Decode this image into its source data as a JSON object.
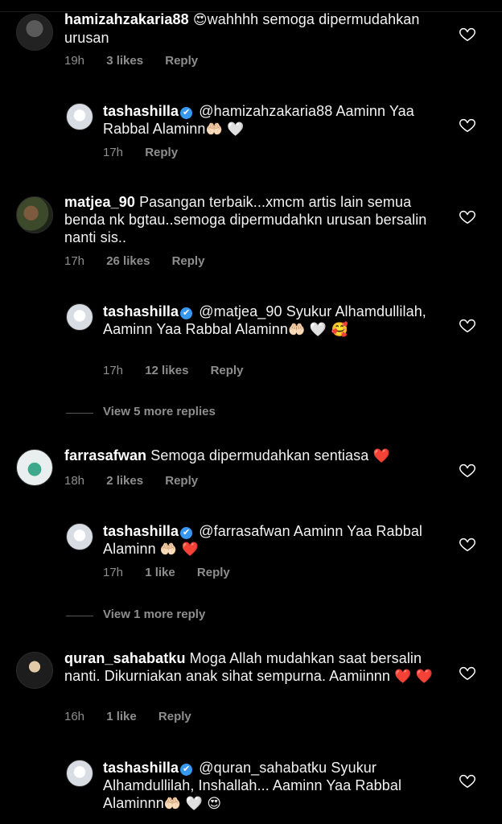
{
  "comments": [
    {
      "user": "hamizahzakaria88",
      "text_prefix": "😍",
      "text": "wahhhh semoga dipermudahkan urusan",
      "time": "19h",
      "likes": "3 likes",
      "reply": "Reply"
    },
    {
      "user": "tashashilla",
      "verified": "✔",
      "mention": "@hamizahzakaria88",
      "text": "Aaminn Yaa Rabbal Alaminn",
      "emojis": "🤲🏻 🤍",
      "time": "17h",
      "reply": "Reply"
    },
    {
      "user": "matjea_90",
      "text": "Pasangan terbaik...xmcm artis lain semua benda nk bgtau..semoga dipermudahkn urusan bersalin nanti sis..",
      "time": "17h",
      "likes": "26 likes",
      "reply": "Reply"
    },
    {
      "user": "tashashilla",
      "verified": "✔",
      "mention": "@matjea_90",
      "text": "Syukur Alhamdullilah, Aaminn Yaa Rabbal Alaminn",
      "emojis": "🤲🏻 🤍 🥰",
      "time": "17h",
      "likes": "12 likes",
      "reply": "Reply"
    },
    {
      "user": "farrasafwan",
      "text": "Semoga dipermudahkan sentiasa",
      "emojis": "❤️",
      "time": "18h",
      "likes": "2 likes",
      "reply": "Reply"
    },
    {
      "user": "tashashilla",
      "verified": "✔",
      "mention": "@farrasafwan",
      "text": "Aaminn Yaa Rabbal Alaminn",
      "emojis": "🤲🏻 ❤️",
      "time": "17h",
      "likes": "1 like",
      "reply": "Reply"
    },
    {
      "user": "quran_sahabatku",
      "text": "Moga Allah mudahkan saat bersalin nanti. Dikurniakan anak sihat sempurna. Aamiinnn",
      "emojis": "❤️ ❤️",
      "time": "16h",
      "likes": "1 like",
      "reply": "Reply"
    },
    {
      "user": "tashashilla",
      "verified": "✔",
      "mention": "@quran_sahabatku",
      "text": "Syukur Alhamdullilah, Inshallah... Aaminn Yaa Rabbal Alaminnn",
      "emojis": "🤲🏻 🤍 😍",
      "reply": ""
    }
  ],
  "view_more": [
    "View 5 more replies",
    "View 1 more reply"
  ],
  "icons": {
    "like": "heart-outline-icon",
    "verified": "verified-badge-icon"
  },
  "colors": {
    "background": "#000000",
    "meta": "#8e8e8e",
    "verified": "#3897f0",
    "heart_red": "#ed2a45"
  }
}
